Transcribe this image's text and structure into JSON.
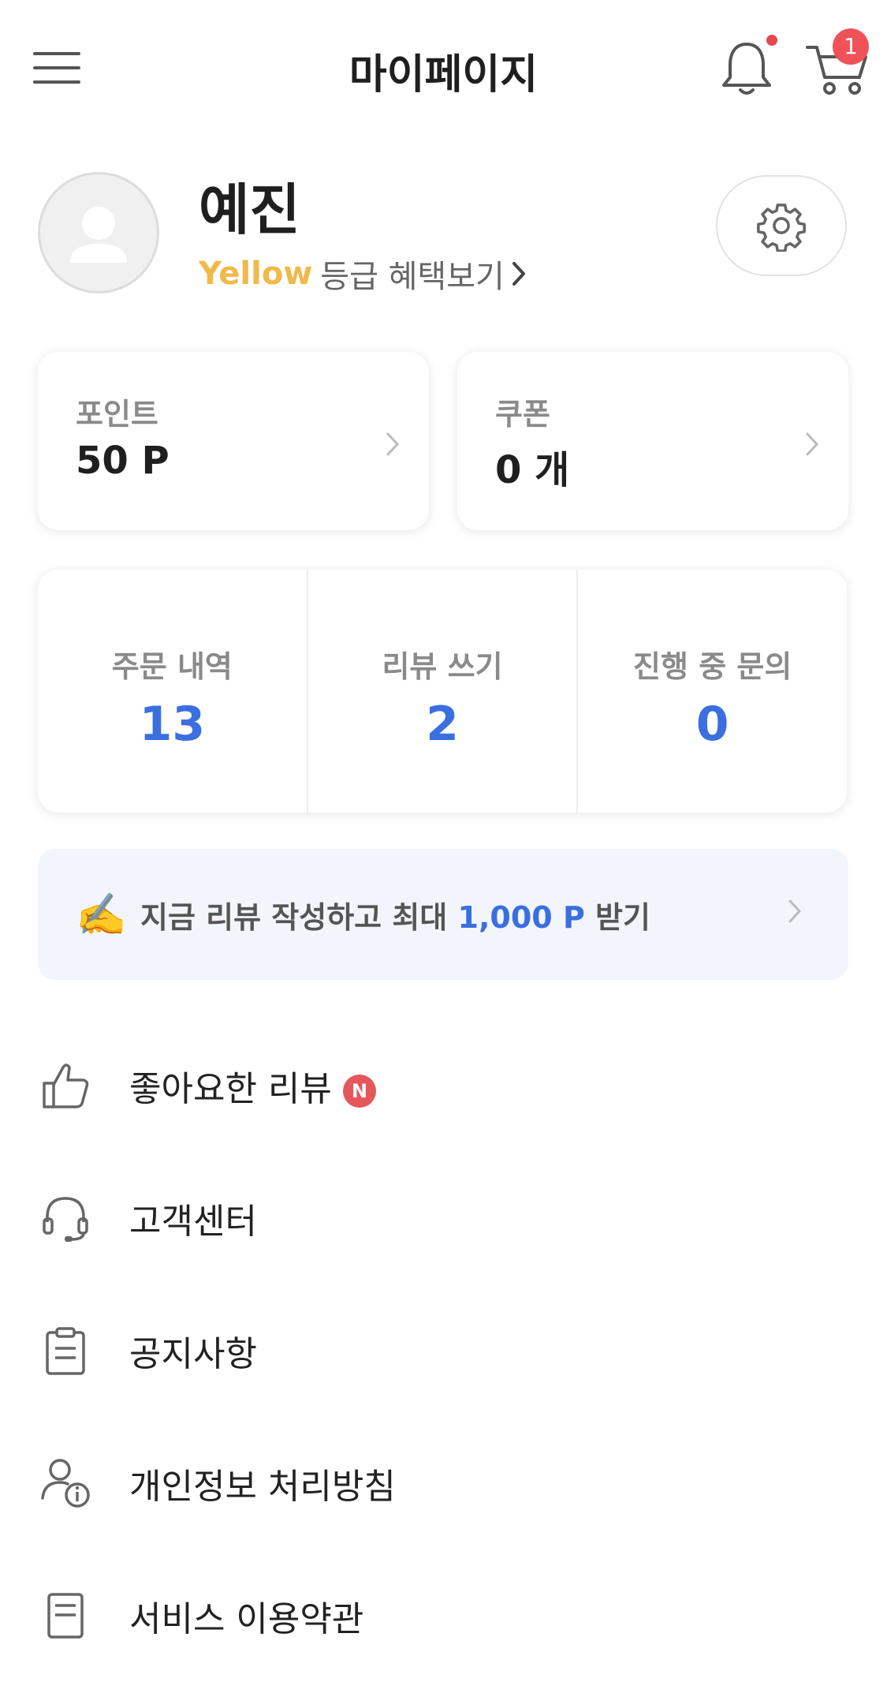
{
  "header": {
    "title": "마이페이지",
    "cart_count": "1",
    "icons": [
      "menu-icon",
      "bell-icon",
      "cart-icon"
    ]
  },
  "profile": {
    "name": "예진",
    "grade": "Yellow",
    "grade_link": "등급 혜택보기",
    "grade_color": "#f0b94a"
  },
  "cards": {
    "point": {
      "label": "포인트",
      "value": "50 P"
    },
    "coupon": {
      "label": "쿠폰",
      "value": "0 개"
    }
  },
  "stats": [
    {
      "label": "주문 내역",
      "value": "13"
    },
    {
      "label": "리뷰 쓰기",
      "value": "2"
    },
    {
      "label": "진행 중 문의",
      "value": "0"
    }
  ],
  "banner": {
    "emoji": "✍️",
    "prefix": "지금 리뷰 작성하고 최대",
    "highlight": "1,000 P",
    "suffix": "받기"
  },
  "menu": [
    {
      "label": "좋아요한 리뷰",
      "icon": "thumbs-up-icon",
      "badge": "N"
    },
    {
      "label": "고객센터",
      "icon": "headset-icon"
    },
    {
      "label": "공지사항",
      "icon": "clipboard-icon"
    },
    {
      "label": "개인정보 처리방침",
      "icon": "user-info-icon"
    },
    {
      "label": "서비스 이용약관",
      "icon": "document-icon"
    }
  ],
  "colors": {
    "accent": "#3b6fe0",
    "badge_red": "#f0525a",
    "banner_bg": "#f2f6fc"
  }
}
